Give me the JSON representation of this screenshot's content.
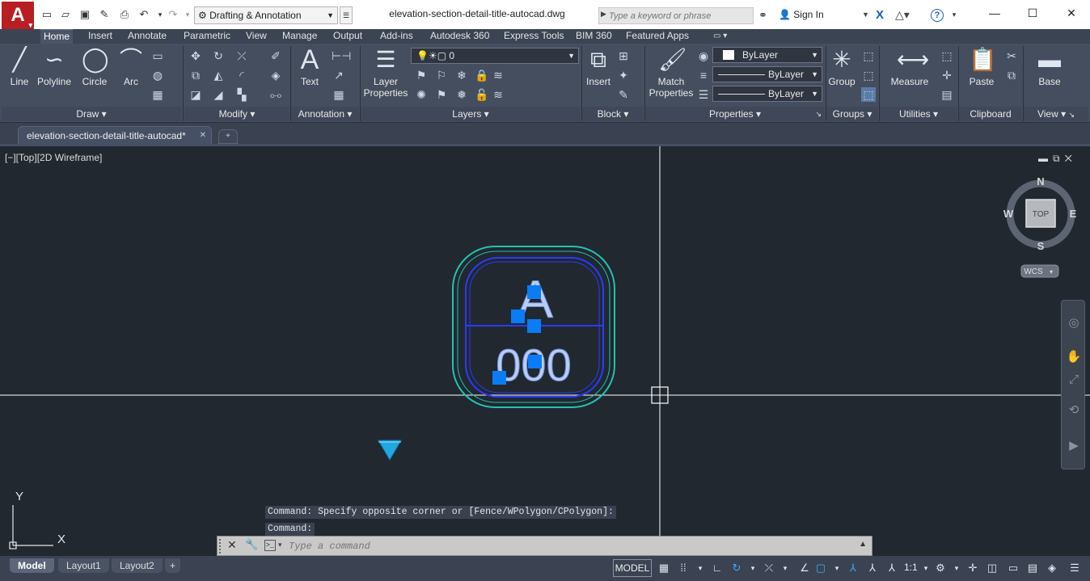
{
  "titlebar": {
    "logo_letter": "A",
    "workspace": "Drafting & Annotation",
    "document_title": "elevation-section-detail-title-autocad.dwg",
    "search_placeholder": "Type a keyword or phrase",
    "signin": "Sign In"
  },
  "menu": {
    "tabs": [
      "Home",
      "Insert",
      "Annotate",
      "Parametric",
      "View",
      "Manage",
      "Output",
      "Add-ins",
      "Autodesk 360",
      "Express Tools",
      "BIM 360",
      "Featured Apps"
    ],
    "active": "Home"
  },
  "ribbon": {
    "draw": {
      "line": "Line",
      "polyline": "Polyline",
      "circle": "Circle",
      "arc": "Arc",
      "footer": "Draw"
    },
    "modify": {
      "footer": "Modify"
    },
    "annotation": {
      "text": "Text",
      "footer": "Annotation"
    },
    "layers": {
      "layer_properties": "Layer Properties",
      "layer_value": "0",
      "footer": "Layers"
    },
    "block": {
      "insert": "Insert",
      "footer": "Block"
    },
    "properties": {
      "match": "Match Properties",
      "color": "ByLayer",
      "linetype": "ByLayer",
      "lineweight": "ByLayer",
      "footer": "Properties"
    },
    "groups": {
      "group": "Group",
      "footer": "Groups"
    },
    "utilities": {
      "measure": "Measure",
      "footer": "Utilities"
    },
    "clipboard": {
      "paste": "Paste",
      "footer": "Clipboard"
    },
    "view": {
      "base": "Base",
      "footer": "View"
    }
  },
  "doctab": {
    "name": "elevation-section-detail-title-autocad*"
  },
  "viewport": {
    "label": "[−][Top][2D Wireframe]",
    "viewcube": {
      "n": "N",
      "s": "S",
      "e": "E",
      "w": "W",
      "face": "TOP",
      "wcs": "WCS"
    },
    "ucs": {
      "x": "X",
      "y": "Y"
    },
    "symbol": {
      "letter": "A",
      "number": "000"
    }
  },
  "command": {
    "history": [
      "Command: Specify opposite corner or [Fence/WPolygon/CPolygon]:",
      "Command:"
    ],
    "placeholder": "Type a command"
  },
  "status": {
    "layout_tabs": [
      "Model",
      "Layout1",
      "Layout2"
    ],
    "active_layout": "Model",
    "model": "MODEL",
    "scale": "1:1"
  },
  "colors": {
    "selection_outer": "#27c0b0",
    "selection_inner": "#2a3cff",
    "grip": "#0a7cf5",
    "text_fill": "#b9cdf2",
    "crosshair": "#ffffff"
  }
}
